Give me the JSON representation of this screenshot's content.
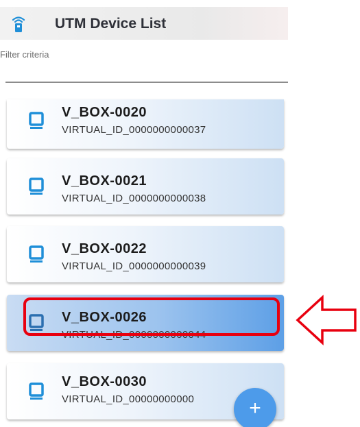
{
  "app": {
    "title": "UTM Device List",
    "icon": "router-wifi-icon"
  },
  "filter": {
    "label": "Filter criteria",
    "value": ""
  },
  "devices": [
    {
      "name": "V_BOX-0020",
      "id": "VIRTUAL_ID_0000000000037",
      "selected": false
    },
    {
      "name": "V_BOX-0021",
      "id": "VIRTUAL_ID_0000000000038",
      "selected": false
    },
    {
      "name": "V_BOX-0022",
      "id": "VIRTUAL_ID_0000000000039",
      "selected": false
    },
    {
      "name": "V_BOX-0026",
      "id": "VIRTUAL_ID_0000000000044",
      "selected": true
    },
    {
      "name": "V_BOX-0030",
      "id": "VIRTUAL_ID_00000000000",
      "selected": false
    }
  ],
  "fab": {
    "label": "+",
    "icon": "plus-icon"
  },
  "annotation": {
    "color": "#e8000f",
    "icon": "left-arrow-icon"
  },
  "colors": {
    "accent": "#4d9bea",
    "device_icon": "#1f8fd8"
  }
}
